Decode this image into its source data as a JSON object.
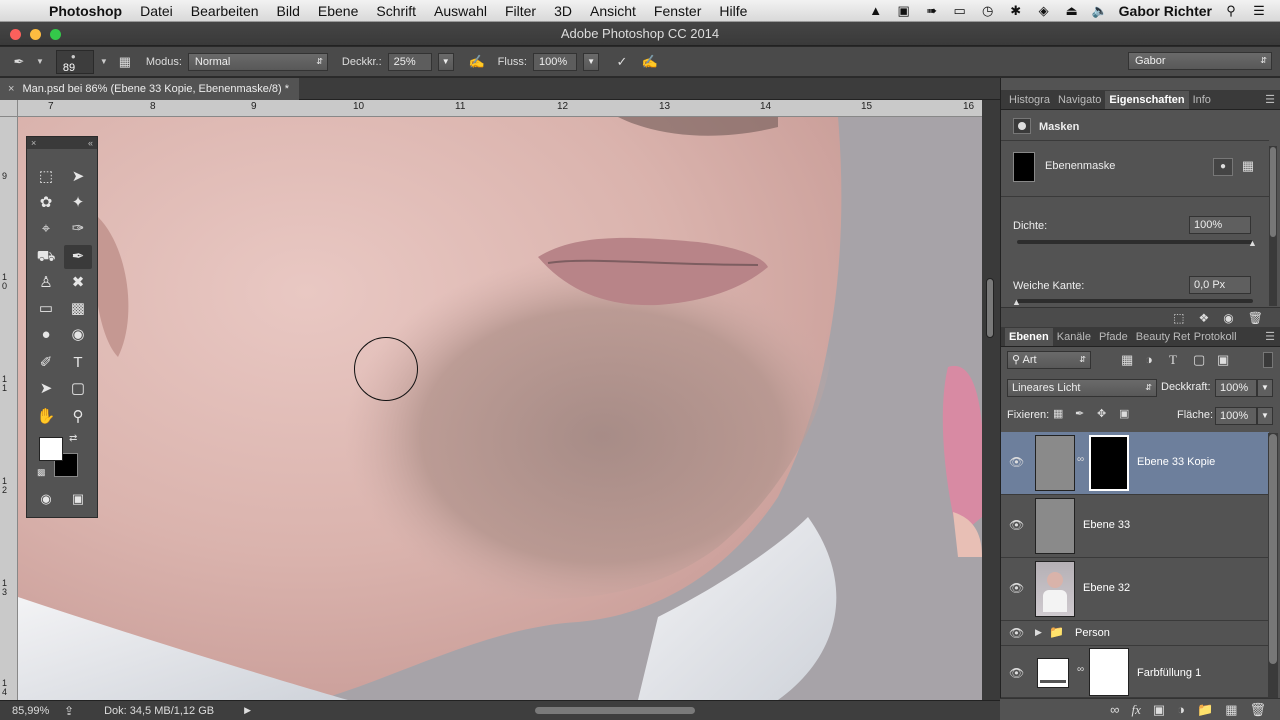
{
  "menubar": {
    "app": "Photoshop",
    "items": [
      "Datei",
      "Bearbeiten",
      "Bild",
      "Ebene",
      "Schrift",
      "Auswahl",
      "Filter",
      "3D",
      "Ansicht",
      "Fenster",
      "Hilfe"
    ],
    "user": "Gabor Richter"
  },
  "window": {
    "title": "Adobe Photoshop CC 2014"
  },
  "options": {
    "brush_size": "89",
    "mode_label": "Modus:",
    "mode_value": "Normal",
    "opacity_label": "Deckkr.:",
    "opacity_value": "25%",
    "flow_label": "Fluss:",
    "flow_value": "100%",
    "workspace": "Gabor"
  },
  "document": {
    "tab_title": "Man.psd bei 86% (Ebene 33 Kopie, Ebenenmaske/8) *",
    "ruler_top": [
      "7",
      "8",
      "9",
      "10",
      "11",
      "12",
      "13",
      "14",
      "15",
      "16"
    ],
    "ruler_left": [
      "9",
      "1 0",
      "1 1",
      "1 2",
      "1 3",
      "1 4"
    ]
  },
  "status": {
    "zoom": "85,99%",
    "doc": "Dok: 34,5 MB/1,12 GB"
  },
  "properties": {
    "tabs": [
      "Histogra",
      "Navigato",
      "Eigenschaften",
      "Info"
    ],
    "active_tab": "Eigenschaften",
    "header": "Masken",
    "mask_label": "Ebenenmaske",
    "density_label": "Dichte:",
    "density_value": "100%",
    "density_fraction": 1.0,
    "feather_label": "Weiche Kante:",
    "feather_value": "0,0 Px",
    "feather_fraction": 0.0
  },
  "layers_panel": {
    "tabs": [
      "Ebenen",
      "Kanäle",
      "Pfade",
      "Beauty Ret",
      "Protokoll"
    ],
    "filter_value": "Art",
    "blend_mode": "Lineares Licht",
    "opacity_label": "Deckkraft:",
    "opacity_value": "100%",
    "lock_label": "Fixieren:",
    "fill_label": "Fläche:",
    "fill_value": "100%",
    "layers": [
      {
        "name": "Ebene 33 Kopie",
        "selected": true
      },
      {
        "name": "Ebene 33",
        "selected": false
      },
      {
        "name": "Ebene 32",
        "selected": false
      },
      {
        "name": "Person",
        "selected": false
      },
      {
        "name": "Farbfüllung 1",
        "selected": false
      }
    ]
  },
  "colors": {
    "selection": "#6d7f9c",
    "panel": "#535353",
    "foreground": "#ffffff",
    "background": "#000000"
  }
}
